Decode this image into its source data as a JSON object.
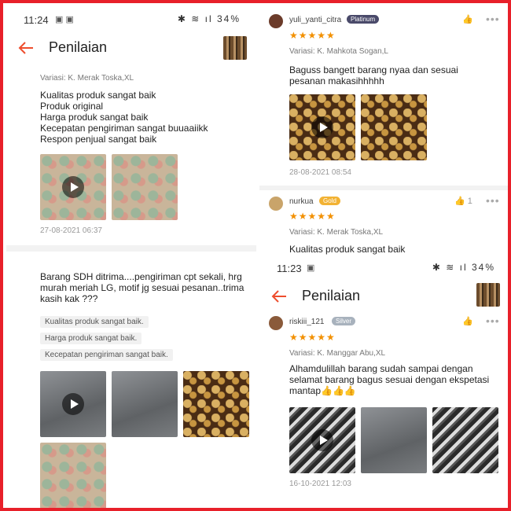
{
  "colors": {
    "frame": "#e8202a",
    "accent": "#ee4d2d",
    "star": "#f29000",
    "platinum": "#4a4a6a",
    "gold": "#f2b233",
    "silver": "#a8b2bd"
  },
  "left": {
    "status": {
      "time": "11:24",
      "battery": "34%"
    },
    "header": {
      "title": "Penilaian"
    },
    "review1": {
      "variasi": "Variasi: K. Merak Toska,XL",
      "lines": [
        "Kualitas produk sangat baik",
        "Produk original",
        "Harga produk sangat baik",
        "Kecepatan pengiriman sangat buuaaiikk",
        "Respon penjual sangat baik"
      ],
      "date": "27-08-2021 06:37"
    },
    "review2": {
      "text": "Barang SDH ditrima....pengiriman cpt sekali, hrg murah meriah LG, motif jg sesuai pesanan..trima kasih kak ???",
      "tags": [
        "Kualitas produk sangat baik.",
        "Harga produk sangat baik.",
        "Kecepatan pengiriman sangat baik."
      ]
    }
  },
  "right_top": {
    "review1": {
      "user": "yuli_yanti_citra",
      "badge": "Platinum",
      "stars": "★★★★★",
      "variasi": "Variasi: K. Mahkota Sogan,L",
      "text": "Baguss bangett barang nyaa dan sesuai pesanan makasihhhhh",
      "date": "28-08-2021 08:54"
    },
    "review2": {
      "user": "nurkua",
      "badge": "Gold",
      "stars": "★★★★★",
      "likes": "1",
      "variasi": "Variasi: K. Merak Toska,XL",
      "text": "Kualitas produk sangat baik"
    }
  },
  "right_bottom": {
    "status": {
      "time": "11:23",
      "battery": "34%"
    },
    "header": {
      "title": "Penilaian"
    },
    "review1": {
      "user": "riskiii_121",
      "badge": "Silver",
      "stars": "★★★★★",
      "variasi": "Variasi: K. Manggar Abu,XL",
      "text": "Alhamdulillah barang sudah sampai dengan selamat barang bagus sesuai dengan ekspetasi mantap👍👍👍",
      "date": "16-10-2021 12:03"
    }
  }
}
